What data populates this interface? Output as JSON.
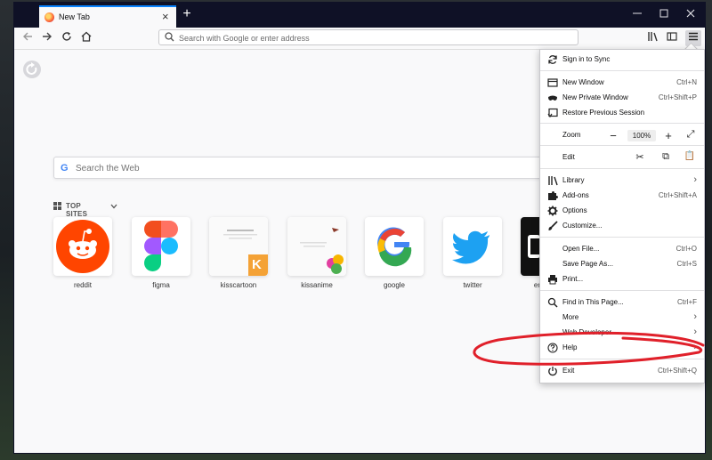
{
  "browser": {
    "tab_title": "New Tab",
    "new_tab": "+",
    "window_controls": {
      "minimize": "—",
      "maximize": "☐",
      "close": "✕"
    }
  },
  "nav": {
    "url_placeholder": "Search with Google or enter address"
  },
  "newtab": {
    "search_brand": "G",
    "search_placeholder": "Search the Web",
    "top_sites_label": "TOP SITES",
    "tiles": [
      {
        "label": "reddit"
      },
      {
        "label": "figma"
      },
      {
        "label": "kisscartoon"
      },
      {
        "label": "kissanime"
      },
      {
        "label": "google"
      },
      {
        "label": "twitter"
      },
      {
        "label": "er"
      }
    ],
    "google_letter": "G",
    "kisscartoon_letter": "K"
  },
  "menu": {
    "sign_in": "Sign in to Sync",
    "new_window": "New Window",
    "new_window_sc": "Ctrl+N",
    "new_private": "New Private Window",
    "new_private_sc": "Ctrl+Shift+P",
    "restore": "Restore Previous Session",
    "zoom": "Zoom",
    "zoom_minus": "−",
    "zoom_value": "100%",
    "zoom_plus": "+",
    "zoom_full": "⤢",
    "edit": "Edit",
    "cut": "✂",
    "copy": "⧉",
    "paste": "📋",
    "library": "Library",
    "addons": "Add-ons",
    "addons_sc": "Ctrl+Shift+A",
    "options": "Options",
    "customize": "Customize...",
    "open_file": "Open File...",
    "open_file_sc": "Ctrl+O",
    "save_page": "Save Page As...",
    "save_page_sc": "Ctrl+S",
    "print": "Print...",
    "find": "Find in This Page...",
    "find_sc": "Ctrl+F",
    "more": "More",
    "web_dev": "Web Developer",
    "help": "Help",
    "exit": "Exit",
    "exit_sc": "Ctrl+Shift+Q",
    "arrow": "›"
  },
  "colors": {
    "titlebar": "#0f1126",
    "accent": "#0a84ff",
    "reddit": "#ff4500",
    "twitter": "#1da1f2",
    "annotation": "#e0202a"
  }
}
